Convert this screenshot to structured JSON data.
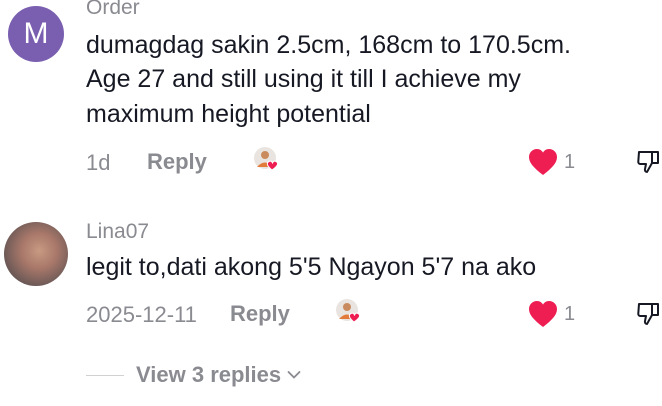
{
  "comments": [
    {
      "username": "Order",
      "avatar_letter": "M",
      "avatar_color": "#7a5fb0",
      "lines": [
        "dumagdag sakin 2.5cm, 168cm to 170.5cm.",
        "Age 27 and still using it till I achieve my",
        "maximum height potential"
      ],
      "time": "1d",
      "reply_label": "Reply",
      "like_count": "1"
    },
    {
      "username": "Lina07",
      "lines": [
        "legit to,dati akong 5'5 Ngayon 5'7 na ako"
      ],
      "time": "2025-12-11",
      "reply_label": "Reply",
      "like_count": "1"
    }
  ],
  "view_replies_label": "View 3 replies",
  "colors": {
    "heart": "#ee1d52",
    "muted": "#8a8b91",
    "text": "#161823"
  },
  "icons": {
    "like": "heart-icon",
    "dislike": "thumbs-down-icon",
    "creator": "creator-liked-badge-icon",
    "expand": "chevron-down-icon"
  }
}
